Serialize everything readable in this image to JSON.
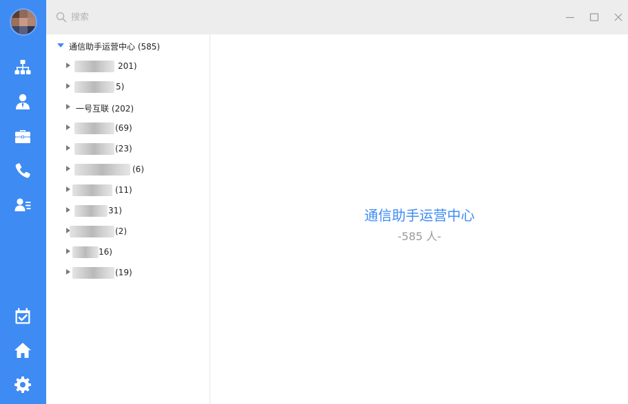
{
  "search": {
    "placeholder": "搜索"
  },
  "tree": {
    "root": {
      "label": "通信助手运营中心 (585)"
    },
    "children": [
      {
        "label": "",
        "count": "201)"
      },
      {
        "label": "",
        "count": "5)"
      },
      {
        "label": "一号互联 (202)",
        "count": ""
      },
      {
        "label": "",
        "count": "(69)"
      },
      {
        "label": "",
        "count": "(23)"
      },
      {
        "label": "",
        "count": "(6)"
      },
      {
        "label": "",
        "count": "(11)"
      },
      {
        "label": "",
        "count": "31)"
      },
      {
        "label": "",
        "count": "(2)"
      },
      {
        "label": "",
        "count": "16)"
      },
      {
        "label": "",
        "count": "(19)"
      }
    ]
  },
  "detail": {
    "title": "通信助手运营中心",
    "count": "-585 人-"
  },
  "colors": {
    "accent": "#3e8bf3",
    "rail": "#3e8bf3",
    "topbar": "#ededed"
  },
  "icons": [
    "org-chart-icon",
    "contact-icon",
    "briefcase-icon",
    "phone-icon",
    "contact-card-icon",
    "calendar-check-icon",
    "home-icon",
    "settings-gear-icon",
    "search-icon",
    "minimize-icon",
    "maximize-icon",
    "close-icon"
  ]
}
